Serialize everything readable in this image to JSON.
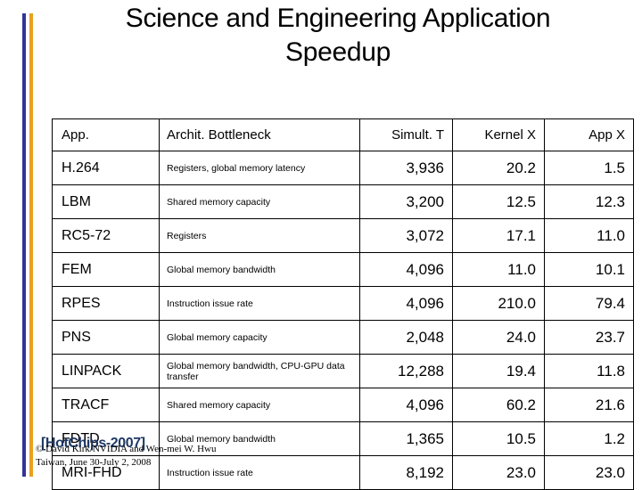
{
  "slide": {
    "title": "Science and Engineering Application\nSpeedup",
    "accent_bar_colors": {
      "primary": "#333399",
      "secondary": "#E8A020"
    }
  },
  "table": {
    "headers": {
      "app": "App.",
      "bottleneck": "Archit. Bottleneck",
      "simult": "Simult. T",
      "kernel": "Kernel X",
      "appx": "App X"
    },
    "rows": [
      {
        "app": "H.264",
        "bottleneck": "Registers,  global memory latency",
        "simult": "3,936",
        "kernel": "20.2",
        "appx": "1.5"
      },
      {
        "app": "LBM",
        "bottleneck": "Shared memory capacity",
        "simult": "3,200",
        "kernel": "12.5",
        "appx": "12.3"
      },
      {
        "app": "RC5-72",
        "bottleneck": "Registers",
        "simult": "3,072",
        "kernel": "17.1",
        "appx": "11.0"
      },
      {
        "app": "FEM",
        "bottleneck": "Global memory bandwidth",
        "simult": "4,096",
        "kernel": "11.0",
        "appx": "10.1"
      },
      {
        "app": "RPES",
        "bottleneck": "Instruction issue rate",
        "simult": "4,096",
        "kernel": "210.0",
        "appx": "79.4"
      },
      {
        "app": "PNS",
        "bottleneck": "Global memory capacity",
        "simult": "2,048",
        "kernel": "24.0",
        "appx": "23.7"
      },
      {
        "app": "LINPACK",
        "bottleneck": "Global memory bandwidth, CPU-GPU data transfer",
        "simult": "12,288",
        "kernel": "19.4",
        "appx": "11.8"
      },
      {
        "app": "TRACF",
        "bottleneck": "Shared memory capacity",
        "simult": "4,096",
        "kernel": "60.2",
        "appx": "21.6"
      },
      {
        "app": "FDTD",
        "bottleneck": "Global memory bandwidth",
        "simult": "1,365",
        "kernel": "10.5",
        "appx": "1.2"
      },
      {
        "app": "MRI-FHD",
        "bottleneck": "Instruction issue rate",
        "simult": "8,192",
        "kernel": "23.0",
        "appx": "23.0"
      }
    ]
  },
  "footer": {
    "reference": "[HotChips-2007]",
    "credit": "© David Kirk/NVIDIA and Wen-mei W. Hwu",
    "venue": "Taiwan, June 30-July 2, 2008"
  }
}
